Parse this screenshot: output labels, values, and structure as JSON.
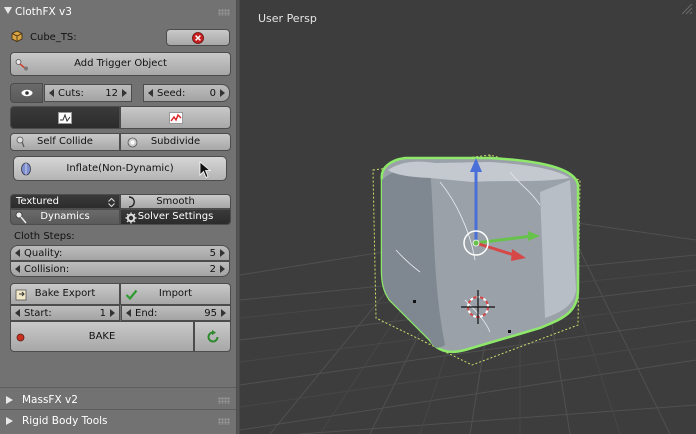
{
  "panels": {
    "clothfx_title": "ClothFX v3",
    "massfx_title": "MassFX v2",
    "rigid_title": "Rigid Body Tools"
  },
  "object": {
    "name": "Cube_TS:"
  },
  "buttons": {
    "add_trigger": "Add Trigger Object",
    "self_collide": "Self Collide",
    "subdivide": "Subdivide",
    "inflate": "Inflate(Non-Dynamic)",
    "smooth": "Smooth",
    "dynamics": "Dynamics",
    "solver_settings": "Solver Settings",
    "bake_export": "Bake Export",
    "import": "Import",
    "bake": "BAKE"
  },
  "fields": {
    "cuts": {
      "label": "Cuts:",
      "value": "12"
    },
    "seed": {
      "label": "Seed:",
      "value": "0"
    },
    "quality": {
      "label": "Quality:",
      "value": "5"
    },
    "collision": {
      "label": "Collision:",
      "value": "2"
    },
    "start": {
      "label": "Start:",
      "value": "1"
    },
    "end": {
      "label": "End:",
      "value": "95"
    }
  },
  "shading": {
    "selected": "Textured"
  },
  "cloth_steps_label": "Cloth Steps:",
  "viewport": {
    "title": "User Persp"
  },
  "colors": {
    "panel_bg": "#727272",
    "viewport_bg": "#3d3d3d",
    "selection_outline": "#8ee86a",
    "axis_blue": "#4a6fd8",
    "axis_green": "#67c24b",
    "axis_red": "#d64848"
  }
}
